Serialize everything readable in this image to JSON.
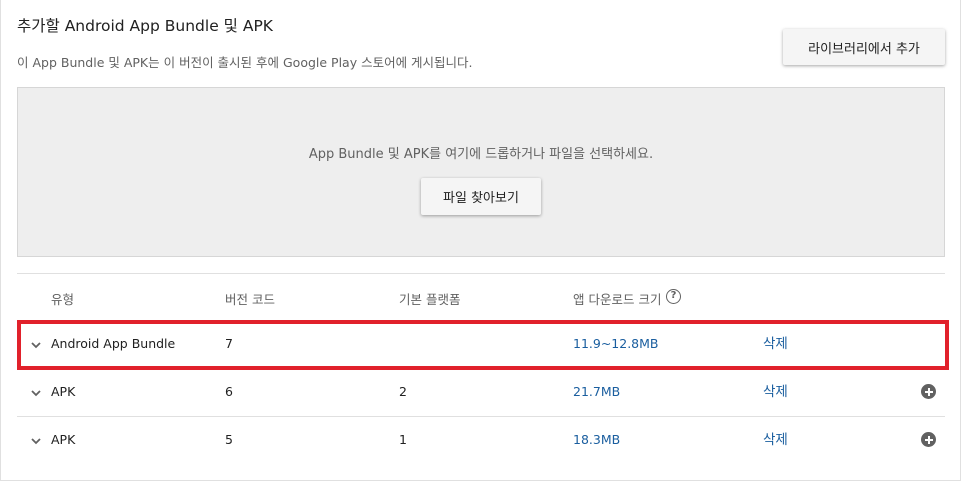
{
  "header": {
    "title": "추가할 Android App Bundle 및 APK",
    "subtitle": "이 App Bundle 및 APK는 이 버전이 출시된 후에 Google Play 스토어에 게시됩니다.",
    "library_button": "라이브러리에서 추가"
  },
  "dropzone": {
    "instruction": "App Bundle 및 APK를 여기에 드롭하거나 파일을 선택하세요.",
    "browse_button": "파일 찾아보기"
  },
  "table": {
    "columns": {
      "type": "유형",
      "version_code": "버전 코드",
      "base_platform": "기본 플랫폼",
      "download_size": "앱 다운로드 크기",
      "help_icon": "help-icon"
    },
    "rows": [
      {
        "type": "Android App Bundle",
        "version_code": "7",
        "base_platform": "",
        "size": "11.9~12.8MB",
        "delete": "삭제",
        "has_add": false,
        "highlighted": true
      },
      {
        "type": "APK",
        "version_code": "6",
        "base_platform": "2",
        "size": "21.7MB",
        "delete": "삭제",
        "has_add": true,
        "highlighted": false
      },
      {
        "type": "APK",
        "version_code": "5",
        "base_platform": "1",
        "size": "18.3MB",
        "delete": "삭제",
        "has_add": true,
        "highlighted": false
      }
    ]
  },
  "colors": {
    "link": "#1a5e9f",
    "highlight": "#e1212b",
    "dropzone_bg": "#eeeeee"
  }
}
